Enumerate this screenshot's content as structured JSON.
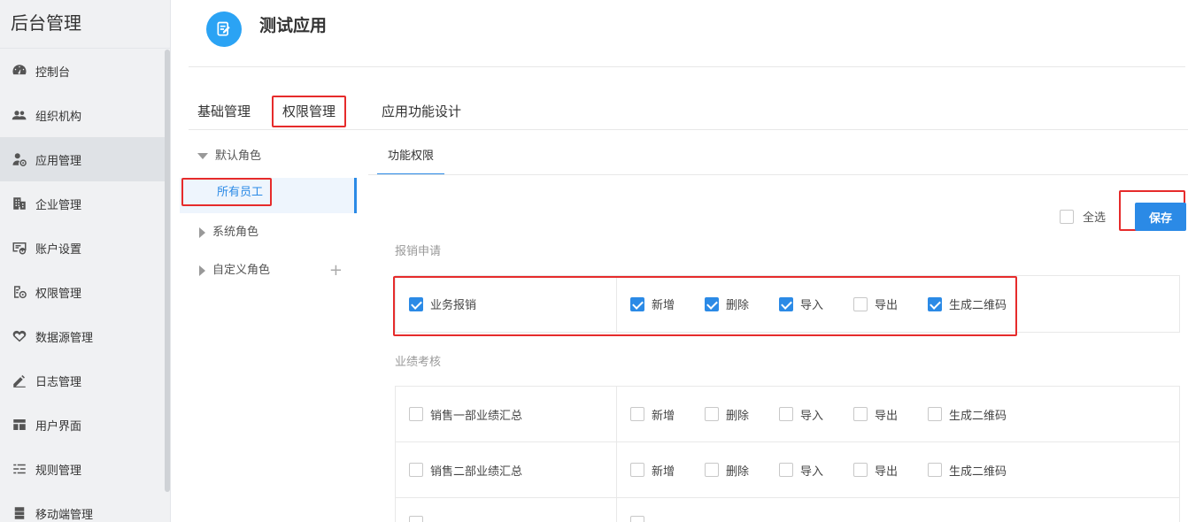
{
  "sidebar": {
    "brand": "后台管理",
    "items": [
      {
        "label": "控制台",
        "icon": "dashboard-icon"
      },
      {
        "label": "组织机构",
        "icon": "users-icon"
      },
      {
        "label": "应用管理",
        "icon": "app-settings-icon",
        "active": true
      },
      {
        "label": "企业管理",
        "icon": "building-icon"
      },
      {
        "label": "账户设置",
        "icon": "account-settings-icon"
      },
      {
        "label": "权限管理",
        "icon": "permission-icon"
      },
      {
        "label": "数据源管理",
        "icon": "datasource-icon"
      },
      {
        "label": "日志管理",
        "icon": "log-icon"
      },
      {
        "label": "用户界面",
        "icon": "layout-icon"
      },
      {
        "label": "规则管理",
        "icon": "rules-icon"
      },
      {
        "label": "移动端管理",
        "icon": "mobile-icon"
      }
    ]
  },
  "app": {
    "title": "测试应用",
    "icon": "edit-icon",
    "accent": "#2ba3f4"
  },
  "tabs": [
    {
      "label": "基础管理"
    },
    {
      "label": "权限管理",
      "active": true
    },
    {
      "label": "应用功能设计"
    }
  ],
  "roles": {
    "default_group": "默认角色",
    "selected_role": "所有员工",
    "system_group": "系统角色",
    "custom_group": "自定义角色",
    "add_symbol": "+"
  },
  "content": {
    "subtab": "功能权限",
    "select_all": "全选",
    "save": "保存",
    "primary_color": "#2b8ae6",
    "highlight_color": "#e62b2b"
  },
  "sections": [
    {
      "title": "报销申请",
      "rows": [
        {
          "name": "业务报销",
          "checked": true,
          "ops": [
            {
              "label": "新增",
              "checked": true
            },
            {
              "label": "删除",
              "checked": true
            },
            {
              "label": "导入",
              "checked": true
            },
            {
              "label": "导出",
              "checked": false
            },
            {
              "label": "生成二维码",
              "checked": true
            }
          ]
        }
      ]
    },
    {
      "title": "业绩考核",
      "rows": [
        {
          "name": "销售一部业绩汇总",
          "checked": false,
          "ops": [
            {
              "label": "新增",
              "checked": false
            },
            {
              "label": "删除",
              "checked": false
            },
            {
              "label": "导入",
              "checked": false
            },
            {
              "label": "导出",
              "checked": false
            },
            {
              "label": "生成二维码",
              "checked": false
            }
          ]
        },
        {
          "name": "销售二部业绩汇总",
          "checked": false,
          "ops": [
            {
              "label": "新增",
              "checked": false
            },
            {
              "label": "删除",
              "checked": false
            },
            {
              "label": "导入",
              "checked": false
            },
            {
              "label": "导出",
              "checked": false
            },
            {
              "label": "生成二维码",
              "checked": false
            }
          ]
        }
      ]
    }
  ]
}
